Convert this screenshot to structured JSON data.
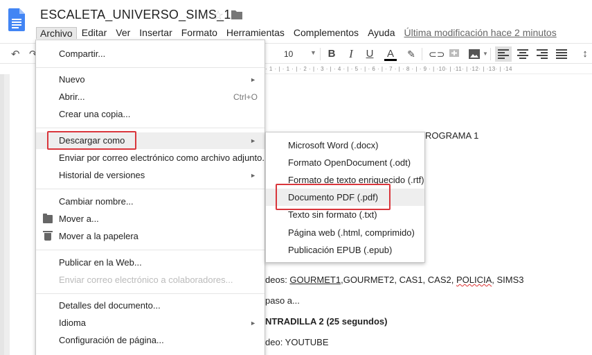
{
  "document": {
    "title": "ESCALETA_UNIVERSO_SIMS_1",
    "star_icon": "star-icon",
    "folder_icon": "folder-icon",
    "logo_icon": "google-docs-icon"
  },
  "menubar": {
    "items": [
      "Archivo",
      "Editar",
      "Ver",
      "Insertar",
      "Formato",
      "Herramientas",
      "Complementos",
      "Ayuda"
    ],
    "active": "Archivo",
    "last_modified": "Última modificación hace 2 minutos"
  },
  "toolbar": {
    "font_size": "10",
    "bold": "B",
    "italic": "I",
    "underline": "U",
    "text_color": "A",
    "icons": [
      "undo-icon",
      "redo-icon",
      "highlight-icon",
      "link-icon",
      "comment-icon",
      "image-icon",
      "align-left-icon",
      "align-center-icon",
      "align-right-icon",
      "justify-icon",
      "line-spacing-icon"
    ]
  },
  "ruler": {
    "text": "· 1 · | · 1 · | · 2 · | · 3 · | · 4 · | · 5 · | · 6 · | · 7 · | · 8 · | · 9 · | ·10· | ·11· | ·12· | ·13· | ·14"
  },
  "file_menu": {
    "share": "Compartir...",
    "new": "Nuevo",
    "open": "Abrir...",
    "open_shortcut": "Ctrl+O",
    "copy": "Crear una copia...",
    "download_as": "Descargar como",
    "email_attachment": "Enviar por correo electrónico como archivo adjunto...",
    "version_history": "Historial de versiones",
    "rename": "Cambiar nombre...",
    "move": "Mover a...",
    "trash": "Mover a la papelera",
    "publish": "Publicar en la Web...",
    "email_collaborators": "Enviar correo electrónico a colaboradores...",
    "details": "Detalles del documento...",
    "language": "Idioma",
    "page_setup": "Configuración de página..."
  },
  "download_submenu": {
    "docx": "Microsoft Word (.docx)",
    "odt": "Formato OpenDocument (.odt)",
    "rtf": "Formato de texto enriquecido (.rtf)",
    "pdf": "Documento PDF (.pdf)",
    "txt": "Texto sin formato (.txt)",
    "html": "Página web (.html, comprimido)",
    "epub": "Publicación EPUB (.epub)"
  },
  "doc_body": {
    "line1": "ROGRAMA 1",
    "line2_prefix": "deos: ",
    "line2_gourmet1": "GOURMET1",
    "line2_mid": ",GOURMET2, CAS1, CAS2, ",
    "line2_policia": "POLICIA",
    "line2_suffix": ", SIMS3",
    "line3": "paso a...",
    "line4": "NTRADILLA 2 (25 segundos)",
    "line5": "deo: YOUTUBE"
  },
  "colors": {
    "highlight_box": "#d9353b",
    "docs_blue": "#4285f4"
  }
}
